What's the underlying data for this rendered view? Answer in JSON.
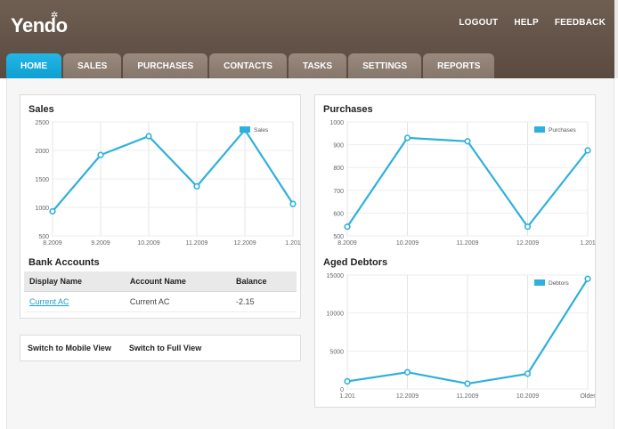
{
  "header": {
    "logo": "Yendo",
    "links": [
      "LOGOUT",
      "HELP",
      "FEEDBACK"
    ]
  },
  "tabs": [
    {
      "label": "HOME",
      "active": true
    },
    {
      "label": "SALES",
      "active": false
    },
    {
      "label": "PURCHASES",
      "active": false
    },
    {
      "label": "CONTACTS",
      "active": false
    },
    {
      "label": "TASKS",
      "active": false
    },
    {
      "label": "SETTINGS",
      "active": false
    },
    {
      "label": "REPORTS",
      "active": false
    }
  ],
  "panels": {
    "sales_title": "Sales",
    "purchases_title": "Purchases",
    "bank_title": "Bank Accounts",
    "aged_title": "Aged Debtors"
  },
  "bank": {
    "headers": [
      "Display Name",
      "Account Name",
      "Balance"
    ],
    "rows": [
      {
        "display_name": "Current AC",
        "account_name": "Current AC",
        "balance": "-2.15"
      }
    ]
  },
  "switch": {
    "mobile": "Switch to Mobile View",
    "full": "Switch to Full View"
  },
  "colors": {
    "brand_header": "#6f5e52",
    "accent": "#23b7e6",
    "line": "#2fb0dc"
  },
  "chart_data": [
    {
      "type": "line",
      "title": "Sales",
      "legend": "Sales",
      "legend_position": "top-right",
      "x": [
        "8.2009",
        "9.2009",
        "10.2009",
        "11.2009",
        "12.2009",
        "1.201"
      ],
      "values": [
        930,
        1920,
        2250,
        1370,
        2360,
        1060
      ],
      "ylim": [
        500,
        2500
      ],
      "yticks": [
        500,
        1000,
        1500,
        2000,
        2500
      ],
      "grid": true
    },
    {
      "type": "line",
      "title": "Purchases",
      "legend": "Purchases",
      "legend_position": "top-right",
      "x": [
        "8.2009",
        "10.2009",
        "11.2009",
        "12.2009",
        "1.201"
      ],
      "values": [
        540,
        930,
        915,
        540,
        875
      ],
      "ylim": [
        500,
        1000
      ],
      "yticks": [
        500,
        600,
        700,
        800,
        900,
        1000
      ],
      "grid": true
    },
    {
      "type": "line",
      "title": "Aged Debtors",
      "legend": "Debtors",
      "legend_position": "top-right",
      "x": [
        "1.201",
        "12.2009",
        "11.2009",
        "10.2009",
        "Older"
      ],
      "values": [
        1000,
        2200,
        700,
        2000,
        14500
      ],
      "ylim": [
        0,
        15000
      ],
      "yticks": [
        0,
        5000,
        10000,
        15000
      ],
      "grid": true
    }
  ]
}
